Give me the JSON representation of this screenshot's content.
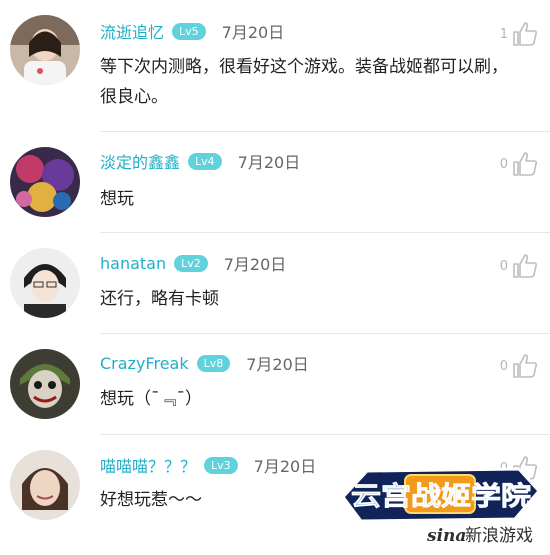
{
  "comments": [
    {
      "user": "流逝追忆",
      "level": "Lv5",
      "date": "7月20日",
      "text": "等下次内测略，很看好这个游戏。装备战姬都可以刷，很良心。",
      "likes": "1"
    },
    {
      "user": "淡定的鑫鑫",
      "level": "Lv4",
      "date": "7月20日",
      "text": "想玩",
      "likes": "0"
    },
    {
      "user": "hanatan",
      "level": "Lv2",
      "date": "7月20日",
      "text": "还行，略有卡顿",
      "likes": "0"
    },
    {
      "user": "CrazyFreak",
      "level": "Lv8",
      "date": "7月20日",
      "text": "想玩（ˉ﹃ˉ）",
      "likes": "0"
    },
    {
      "user": "喵喵喵？？？",
      "level": "Lv3",
      "date": "7月20日",
      "text": "好想玩惹～～",
      "likes": "0"
    }
  ],
  "watermark": {
    "logo": "云宫战姬学院",
    "brand": "新浪游戏",
    "sina": "sina"
  }
}
